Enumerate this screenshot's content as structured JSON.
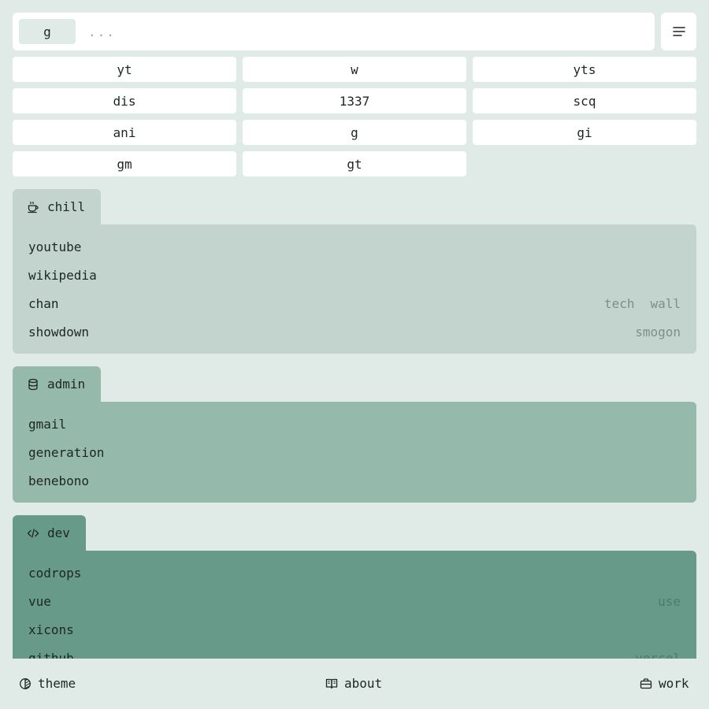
{
  "search": {
    "engine": "g",
    "placeholder": "...",
    "value": ""
  },
  "shortcuts": [
    "yt",
    "w",
    "yts",
    "dis",
    "1337",
    "scq",
    "ani",
    "g",
    "gi",
    "gm",
    "gt"
  ],
  "sections": {
    "chill": {
      "label": "chill",
      "icon": "coffee-icon",
      "links": [
        {
          "name": "youtube",
          "extras": []
        },
        {
          "name": "wikipedia",
          "extras": []
        },
        {
          "name": "chan",
          "extras": [
            "tech",
            "wall"
          ]
        },
        {
          "name": "showdown",
          "extras": [
            "smogon"
          ]
        }
      ]
    },
    "admin": {
      "label": "admin",
      "icon": "database-icon",
      "links": [
        {
          "name": "gmail",
          "extras": []
        },
        {
          "name": "generation",
          "extras": []
        },
        {
          "name": "benebono",
          "extras": []
        }
      ]
    },
    "dev": {
      "label": "dev",
      "icon": "code-icon",
      "links": [
        {
          "name": "codrops",
          "extras": []
        },
        {
          "name": "vue",
          "extras": [
            "use"
          ]
        },
        {
          "name": "xicons",
          "extras": []
        },
        {
          "name": "github",
          "extras": [
            "vercel"
          ]
        }
      ]
    }
  },
  "footer": {
    "theme": "theme",
    "about": "about",
    "work": "work"
  },
  "colors": {
    "background": "#e0eae6",
    "chill": "#c2d4cd",
    "admin": "#95b9ab",
    "dev": "#679a89"
  }
}
